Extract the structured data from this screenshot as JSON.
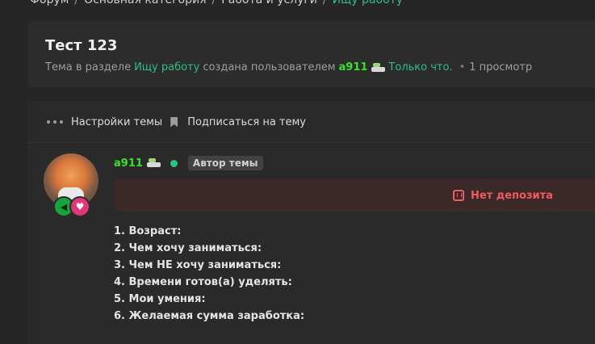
{
  "breadcrumb": {
    "items": [
      "Форум",
      "Основная категория",
      "Работа и услуги"
    ],
    "current": "Ищу работу",
    "separator": "/"
  },
  "topic": {
    "title": "Тест 123",
    "meta_prefix": "Тема в разделе",
    "section": "Ищу работу",
    "created_by": "создана пользователем",
    "author": "a911",
    "time": "Только что.",
    "views": "1 просмотр"
  },
  "actions": {
    "settings_label": "Настройки темы",
    "subscribe_label": "Подписаться на тему"
  },
  "post": {
    "author": "a911",
    "author_badge": "Автор темы",
    "deposit_label": "Нет депозита",
    "lines": [
      "1. Возраст:",
      "2. Чем хочу заниматься:",
      "3. Чем НЕ хочу заниматься:",
      "4. Времени готов(а) уделять:",
      "5. Мои умения:",
      "6. Желаемая сумма заработка:"
    ]
  },
  "icons": [
    "tank-icon",
    "dots-icon",
    "bookmark-icon",
    "heart-icon",
    "online-dot",
    "deposit-icon"
  ],
  "colors": {
    "accent": "#2bc083",
    "username": "#39e22a",
    "danger": "#ef5b61",
    "background": "#262626"
  }
}
